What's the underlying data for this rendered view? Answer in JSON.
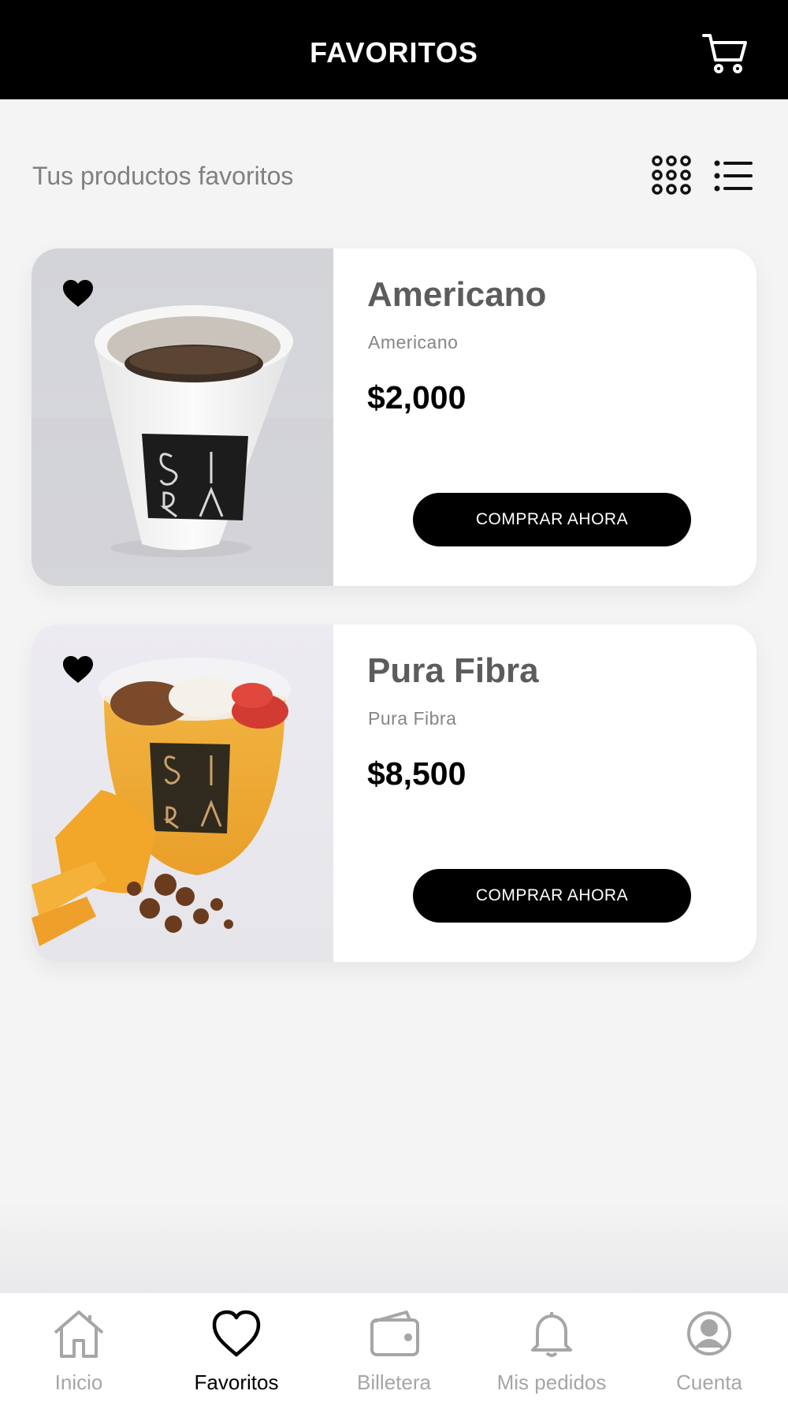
{
  "header": {
    "title": "FAVORITOS",
    "cart_icon": "cart-icon"
  },
  "subheader": {
    "text": "Tus productos favoritos",
    "grid_icon": "grid-view-icon",
    "list_icon": "list-view-icon"
  },
  "products": [
    {
      "name": "Americano",
      "description": "Americano",
      "price": "$2,000",
      "button": "COMPRAR AHORA",
      "favorite": true,
      "logo_text": "SIRA"
    },
    {
      "name": "Pura Fibra",
      "description": "Pura Fibra",
      "price": "$8,500",
      "button": "COMPRAR AHORA",
      "favorite": true,
      "logo_text": "SIRA"
    }
  ],
  "tabbar": {
    "active": "Favoritos",
    "items": [
      {
        "label": "Inicio",
        "icon": "home-icon"
      },
      {
        "label": "Favoritos",
        "icon": "heart-icon"
      },
      {
        "label": "Billetera",
        "icon": "wallet-icon"
      },
      {
        "label": "Mis pedidos",
        "icon": "bell-icon"
      },
      {
        "label": "Cuenta",
        "icon": "account-icon"
      }
    ]
  },
  "colors": {
    "header_bg": "#000000",
    "page_bg": "#f4f4f5",
    "button_bg": "#000000",
    "tab_active": "#000000",
    "tab_inactive": "#a6a6a6"
  }
}
